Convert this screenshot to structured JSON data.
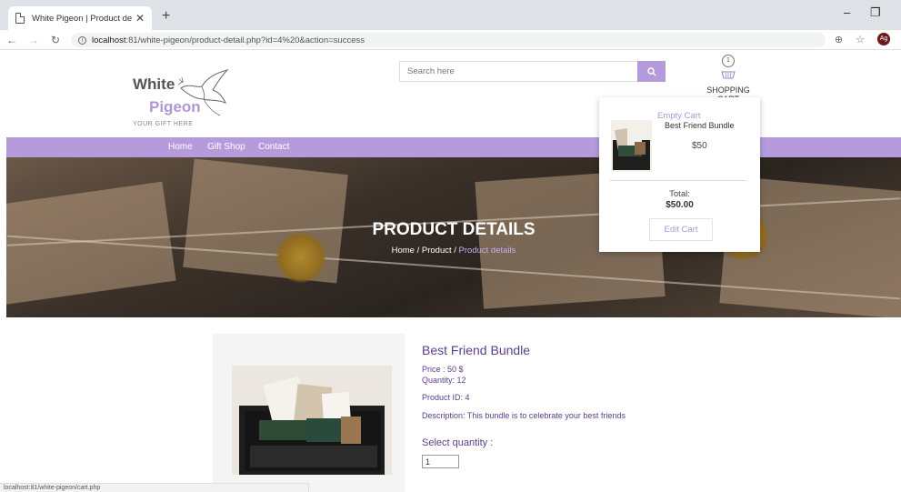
{
  "browser": {
    "tab_title": "White Pigeon | Product details",
    "url_host": "localhost",
    "url_path": ":81/white-pigeon/product-detail.php?id=4%20&action=success",
    "avatar_initials": "Ag",
    "status_url": "localhost:81/white-pigeon/cart.php"
  },
  "header": {
    "logo_line1": "White",
    "logo_line2": "Pigeon",
    "logo_tagline": "YOUR GIFT HERE",
    "search_placeholder": "Search here",
    "cart_count": "1",
    "cart_label": "SHOPPING CART"
  },
  "nav": {
    "items": [
      {
        "label": "Home"
      },
      {
        "label": "Gift Shop"
      },
      {
        "label": "Contact"
      }
    ]
  },
  "hero": {
    "title": "PRODUCT DETAILS",
    "breadcrumb": [
      "Home",
      "Product",
      "Product details"
    ]
  },
  "cart_dropdown": {
    "empty_label": "Empty Cart",
    "item_name": "Best Friend Bundle",
    "item_price": "$50",
    "total_label": "Total:",
    "total_value": "$50.00",
    "edit_label": "Edit Cart"
  },
  "product": {
    "title": "Best Friend Bundle",
    "price_line": "Price : 50 $",
    "quantity_line": "Quantity: 12",
    "id_line": "Product ID: 4",
    "description_line": "Description: This bundle is to celebrate your best friends",
    "select_label": "Select quantity :",
    "qty_value": "1"
  },
  "colors": {
    "accent": "#b59bdc",
    "product_text": "#5a3e8a"
  }
}
